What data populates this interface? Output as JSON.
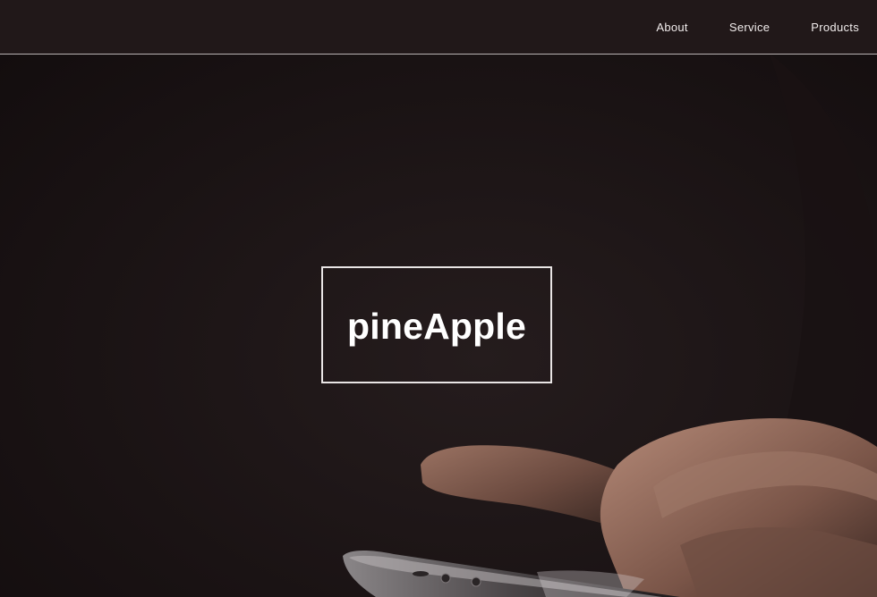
{
  "nav": {
    "items": [
      {
        "label": "About"
      },
      {
        "label": "Service"
      },
      {
        "label": "Products"
      }
    ]
  },
  "hero": {
    "brand": "pineApple",
    "image": "hands-holding-smartphone"
  },
  "colors": {
    "header_bg": "#211819",
    "page_bg": "#1b1415",
    "text": "#ffffff",
    "border": "#e9e5e5"
  }
}
